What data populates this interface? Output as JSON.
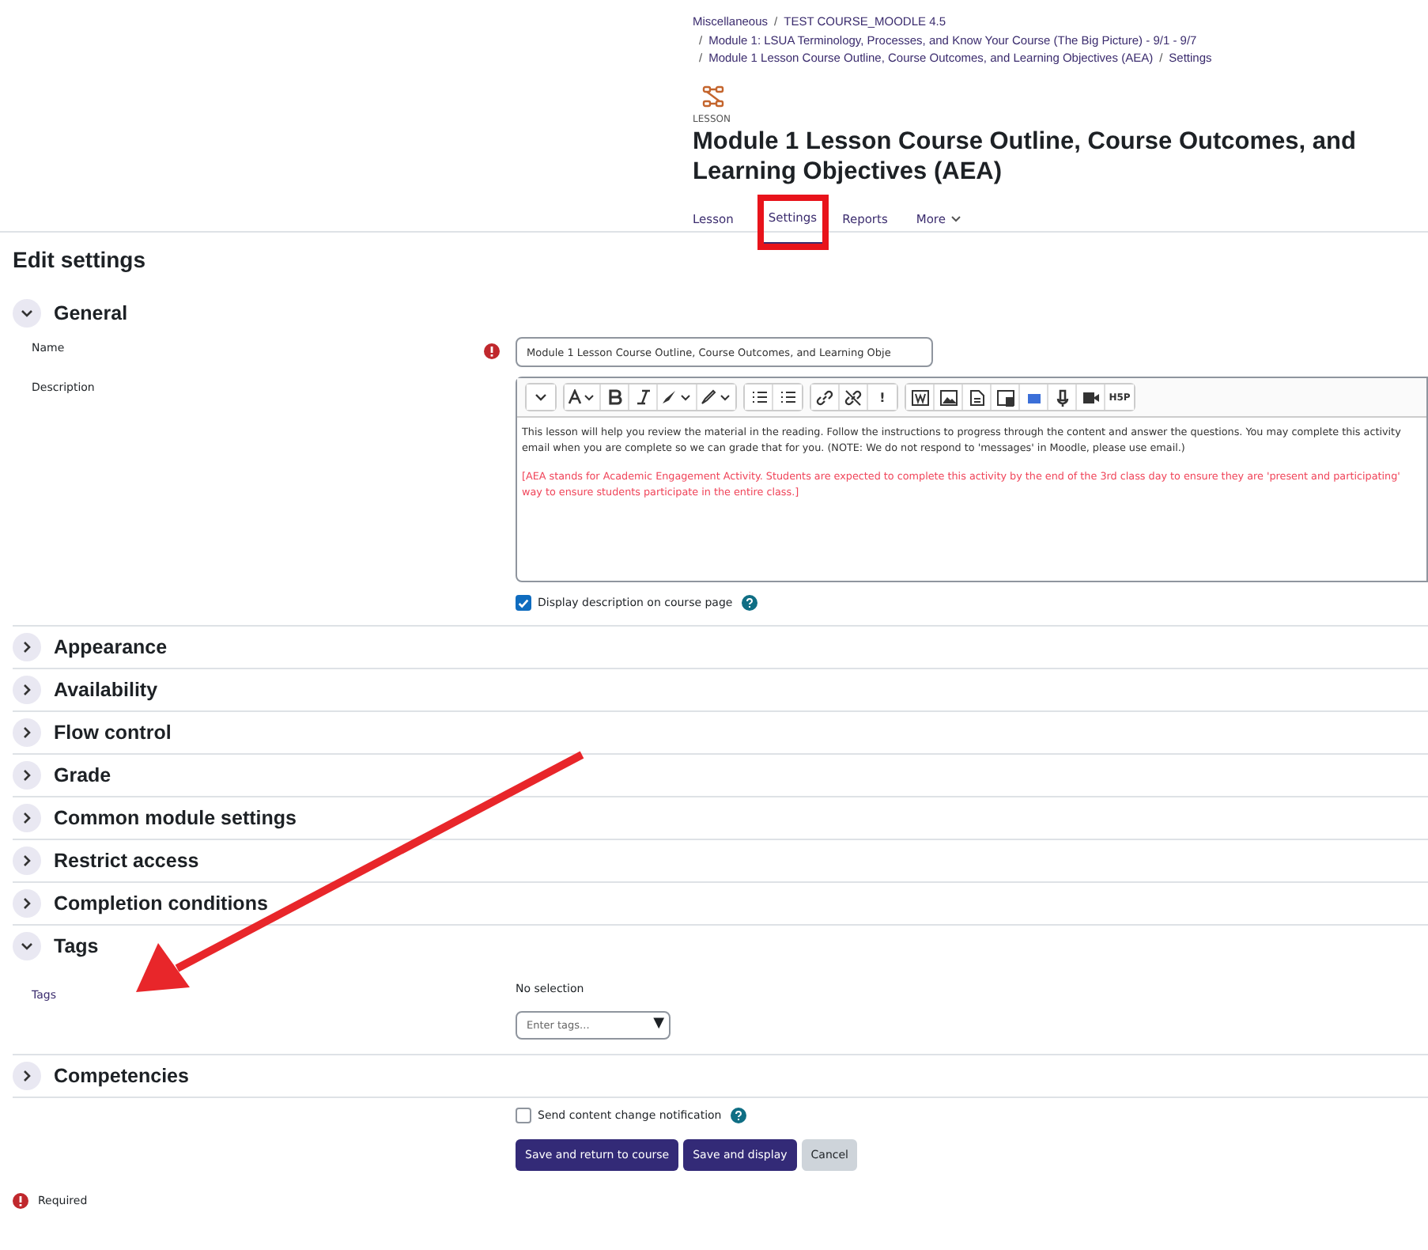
{
  "breadcrumb": {
    "separator": "/",
    "items": [
      {
        "label": "Miscellaneous"
      },
      {
        "label": "TEST COURSE_MOODLE 4.5"
      },
      {
        "label": "Module 1: LSUA Terminology, Processes, and Know Your Course (The Big Picture) - 9/1 - 9/7"
      },
      {
        "label": "Module 1 Lesson Course Outline, Course Outcomes, and Learning Objectives (AEA)"
      },
      {
        "label": "Settings"
      }
    ]
  },
  "activity_type": "LESSON",
  "title": "Module 1 Lesson Course Outline, Course Outcomes, and Learning Objectives (AEA)",
  "tabs": [
    {
      "label": "Lesson",
      "selected": false,
      "highlighted": false,
      "dropdown": false
    },
    {
      "label": "Settings",
      "selected": true,
      "highlighted": true,
      "dropdown": false
    },
    {
      "label": "Reports",
      "selected": false,
      "highlighted": false,
      "dropdown": false
    },
    {
      "label": "More",
      "selected": false,
      "highlighted": false,
      "dropdown": true
    }
  ],
  "page_heading": "Edit settings",
  "sections": [
    {
      "title": "General",
      "expanded": true,
      "kind": "general"
    },
    {
      "title": "Appearance",
      "expanded": false,
      "kind": "plain"
    },
    {
      "title": "Availability",
      "expanded": false,
      "kind": "plain"
    },
    {
      "title": "Flow control",
      "expanded": false,
      "kind": "plain"
    },
    {
      "title": "Grade",
      "expanded": false,
      "kind": "plain"
    },
    {
      "title": "Common module settings",
      "expanded": false,
      "kind": "plain"
    },
    {
      "title": "Restrict access",
      "expanded": false,
      "kind": "plain"
    },
    {
      "title": "Completion conditions",
      "expanded": false,
      "kind": "plain"
    },
    {
      "title": "Tags",
      "expanded": true,
      "kind": "tags"
    },
    {
      "title": "Competencies",
      "expanded": false,
      "kind": "plain"
    }
  ],
  "general": {
    "name": {
      "label": "Name",
      "value": "Module 1 Lesson Course Outline, Course Outcomes, and Learning Obje",
      "required": true
    },
    "description": {
      "label": "Description",
      "paragraphs": [
        {
          "color": "#333333",
          "lines": [
            "This lesson will help you review the material in the reading. Follow the instructions to progress through the content and answer the questions. You may complete this activity",
            "email when you are complete so we can grade that for you.  (NOTE: We do not respond to 'messages' in Moodle, please use email.)"
          ]
        },
        {
          "color": "#f0455a",
          "lines": [
            "[AEA stands for Academic Engagement Activity.  Students are expected to complete this activity by the end of the 3rd class day to ensure they are 'present and participating'",
            "way to ensure students participate in the entire class.]"
          ]
        }
      ],
      "toolbar_glyphs": {
        "warning": "!",
        "h5p": "H5P"
      }
    },
    "display_description": {
      "label": "Display description on course page",
      "checked": true
    }
  },
  "tags": {
    "label": "Tags",
    "selection": "No selection",
    "placeholder": "Enter tags...",
    "caret": "▼"
  },
  "notify": {
    "label": "Send content change notification",
    "checked": false
  },
  "buttons": [
    {
      "label": "Save and return to course",
      "kind": "primary"
    },
    {
      "label": "Save and display",
      "kind": "primary"
    },
    {
      "label": "Cancel",
      "kind": "secondary"
    }
  ],
  "required_note": "Required",
  "annotation_arrow": true
}
